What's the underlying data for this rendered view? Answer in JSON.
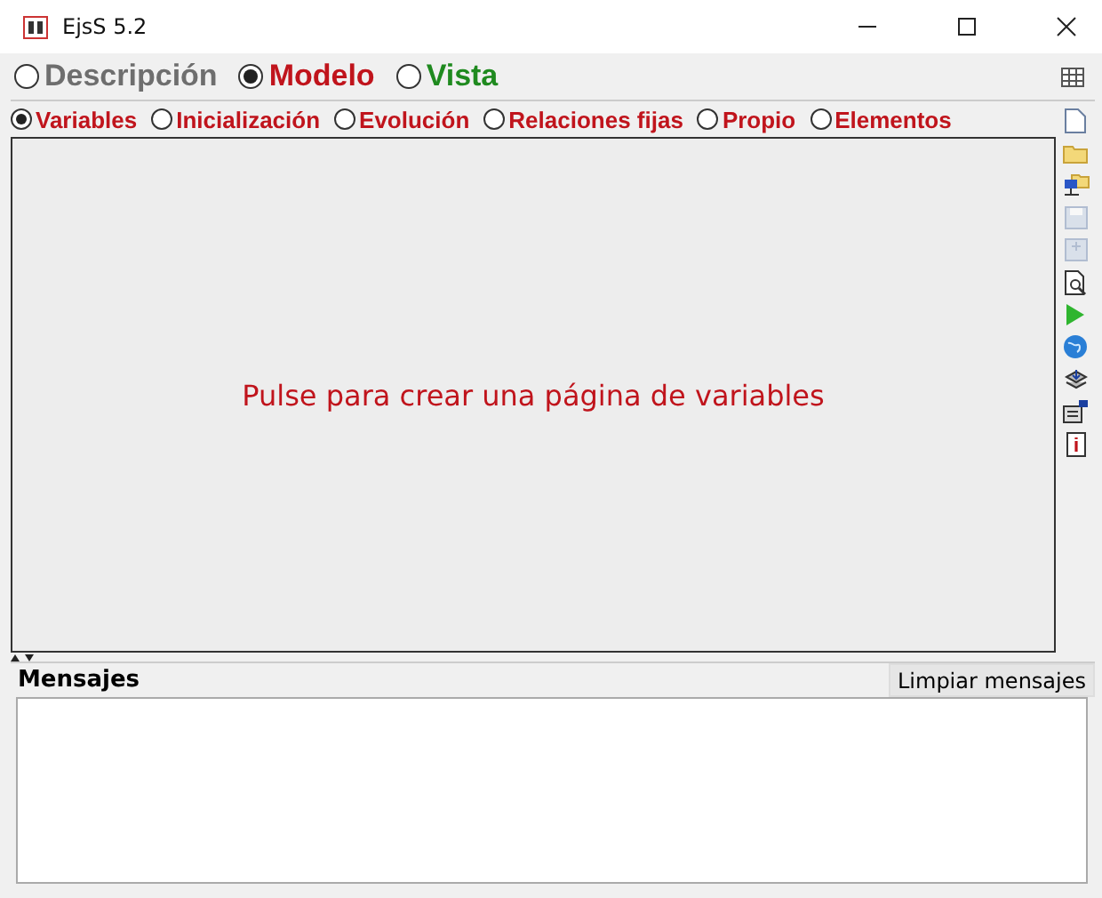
{
  "window": {
    "title": "EjsS 5.2"
  },
  "main_tabs": [
    {
      "label": "Descripción",
      "selected": false,
      "color": "#6e6e6e"
    },
    {
      "label": "Modelo",
      "selected": true,
      "color": "#c0141c"
    },
    {
      "label": "Vista",
      "selected": false,
      "color": "#1f8a1f"
    }
  ],
  "sub_tabs": [
    {
      "label": "Variables",
      "selected": true
    },
    {
      "label": "Inicialización",
      "selected": false
    },
    {
      "label": "Evolución",
      "selected": false
    },
    {
      "label": "Relaciones fijas",
      "selected": false
    },
    {
      "label": "Propio",
      "selected": false
    },
    {
      "label": "Elementos",
      "selected": false
    }
  ],
  "panel": {
    "message": "Pulse para crear una página de variables"
  },
  "toolbar": [
    {
      "kind": "new",
      "disabled": false
    },
    {
      "kind": "open",
      "disabled": false
    },
    {
      "kind": "network",
      "disabled": false
    },
    {
      "kind": "save",
      "disabled": true
    },
    {
      "kind": "saveas",
      "disabled": true
    },
    {
      "kind": "search",
      "disabled": false
    },
    {
      "kind": "run",
      "disabled": false
    },
    {
      "kind": "web",
      "disabled": false
    },
    {
      "kind": "package",
      "disabled": false
    },
    {
      "kind": "export",
      "disabled": false
    },
    {
      "kind": "info",
      "disabled": false
    }
  ],
  "messages": {
    "title": "Mensajes",
    "clear_button": "Limpiar mensajes"
  }
}
